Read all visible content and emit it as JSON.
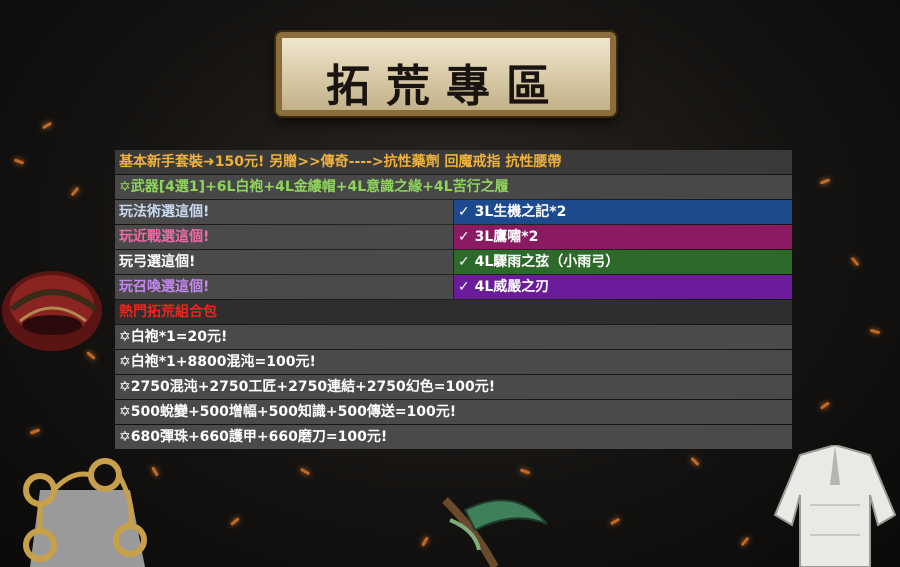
{
  "banner": {
    "title": "拓荒專區"
  },
  "table": {
    "top_line": "基本新手套裝➜150元!   另贈>>傳奇---->抗性藥劑  回魔戒指  抗性腰帶",
    "weapon_line": "✡武器[4選1]+6L白袍+4L金縷帽+4L意識之緣+4L苦行之履",
    "choices": [
      {
        "label": "玩法術選這個!",
        "item": "✓ 3L生機之記*2"
      },
      {
        "label": "玩近戰選這個!",
        "item": "✓ 3L鷹嘯*2"
      },
      {
        "label": "玩弓選這個!",
        "item": "✓ 4L驟雨之弦（小雨弓）"
      },
      {
        "label": "玩召喚選這個!",
        "item": "✓ 4L威嚴之刃"
      }
    ],
    "hot_title": "熱門拓荒組合包",
    "packages": [
      "✡白袍*1=20元!",
      "✡白袍*1+8800混沌=100元!",
      "✡2750混沌+2750工匠+2750連結+2750幻色=100元!",
      "✡500蛻變+500增幅+500知識+500傳送=100元!",
      "✡680彈珠+660護甲+660磨刀=100元!"
    ]
  },
  "colors": {
    "top_line": "#f0b13c",
    "weapon_line": "#8fd55c",
    "hot_title": "#e8271d",
    "caster": "#1c4a8c",
    "melee": "#8a1b62",
    "bow": "#2d6a2a",
    "summon": "#6b1c9b"
  }
}
